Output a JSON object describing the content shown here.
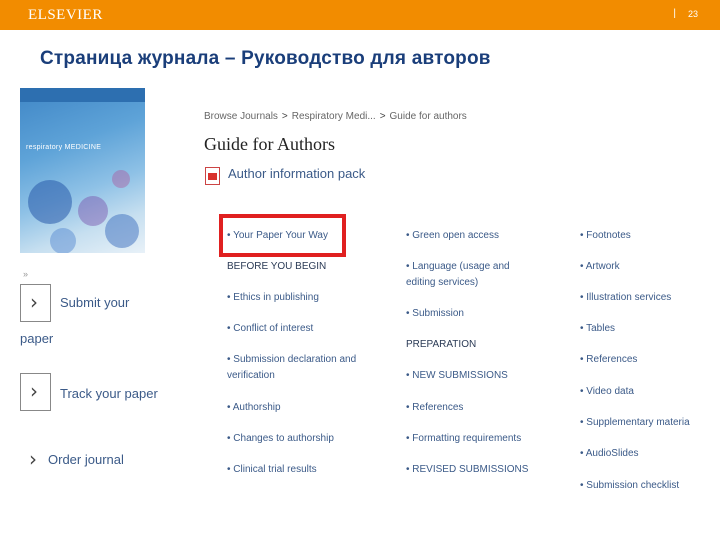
{
  "header": {
    "brand": "ELSEVIER",
    "separator": "|",
    "page_number": "23"
  },
  "slide_title": "Страница журнала – Руководство для авторов",
  "journal_cover": {
    "title": "respiratory MEDICINE"
  },
  "sidebar": {
    "mark": "»",
    "submit_label_1": "Submit your",
    "submit_label_2": "paper",
    "track_label": "Track your paper",
    "order_label": "Order journal",
    "chevron": "›"
  },
  "breadcrumb": {
    "items": [
      "Browse Journals",
      "Respiratory Medi...",
      "Guide for authors"
    ],
    "separator": ">"
  },
  "guide": {
    "title": "Guide for Authors",
    "pack_link": "Author information pack"
  },
  "toc": {
    "col1": {
      "item0": "• Your Paper Your Way",
      "heading1": "BEFORE YOU BEGIN",
      "item2": "• Ethics in publishing",
      "item3": "• Conflict of interest",
      "item4a": "• Submission declaration and",
      "item4b": "verification",
      "item5": "• Authorship",
      "item6": "• Changes to authorship",
      "item7": "• Clinical trial results"
    },
    "col2": {
      "item0": "• Green open access",
      "item1a": "• Language (usage and",
      "item1b": "editing services)",
      "item2": "• Submission",
      "heading3": "PREPARATION",
      "item4": "• NEW SUBMISSIONS",
      "item5": "• References",
      "item6": "• Formatting requirements",
      "item7": "• REVISED SUBMISSIONS"
    },
    "col3": {
      "item0": "• Footnotes",
      "item1": "• Artwork",
      "item2": "• Illustration services",
      "item3": "• Tables",
      "item4": "• References",
      "item5": "• Video data",
      "item6": "• Supplementary materia",
      "item7": "• AudioSlides",
      "item8": "• Submission checklist"
    }
  },
  "colors": {
    "header_bar": "#f28c00",
    "title": "#1a3e7a",
    "link": "#3b5a88",
    "highlight": "#e02020"
  }
}
